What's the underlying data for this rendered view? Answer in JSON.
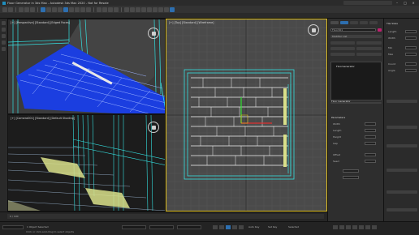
{
  "app": {
    "title": "Floor Generator in 3ds Max - Autodesk 3ds Max 2020 - Not for Resale",
    "accent": "#2d6fb0",
    "wire_color": "#35e0e0",
    "selection_color": "#2060ff"
  },
  "viewports": {
    "top_left_label": "[+] [Perspective] [Standard] [Edged Faces]",
    "top_right_label": "[+] [Top] [Standard] [Wireframe]",
    "bottom_left_label": "[+] [Camera001] [Standard] [Default Shading]",
    "viewcube_icon": "viewcube-icon",
    "gizmo_icon": "transform-gizmo-icon"
  },
  "command_panel": {
    "object_name": "Floor001",
    "modifier_list": "Modifier List",
    "stack_item": "FloorGenerator",
    "rollout_1": "Floor Generator",
    "rollout_2": "Parameters",
    "row_labels": [
      "Width",
      "Length",
      "Height",
      "Gap",
      "Offset",
      "Seed"
    ],
    "right_rollout": "Tile Sizes",
    "right_rows": [
      "Length",
      "Width",
      "Min",
      "Max",
      "Count",
      "Angle"
    ]
  },
  "status": {
    "selection": "1 Object Selected",
    "frame": "0 / 100",
    "prompt": "Click or click-and-drag to select objects",
    "auto_key": "Auto Key",
    "set_key": "Set Key",
    "selected": "Selected"
  }
}
